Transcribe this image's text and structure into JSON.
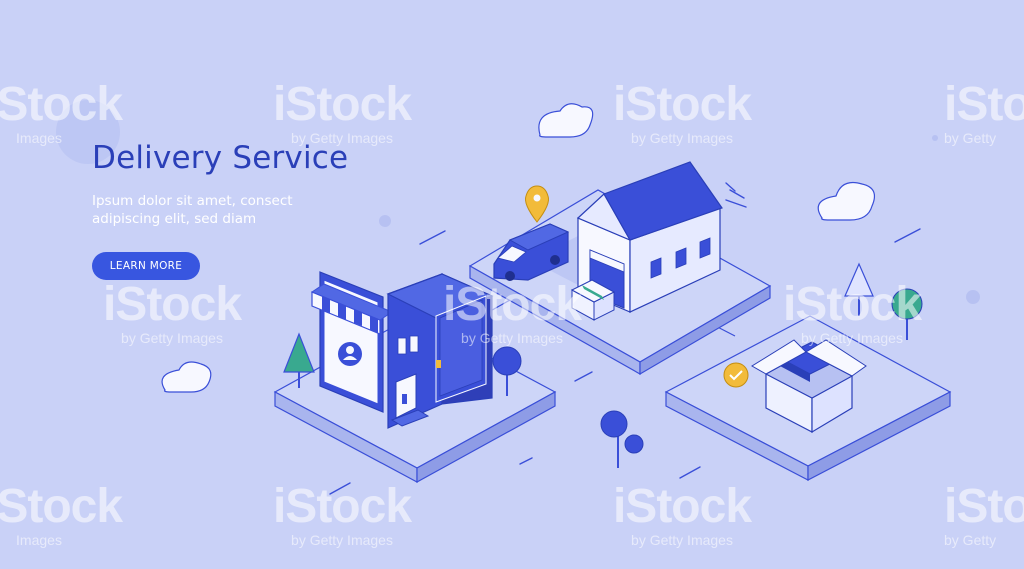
{
  "hero": {
    "title": "Delivery Service",
    "subtitle_line1": "Ipsum dolor sit amet, consect",
    "subtitle_line2": "adipiscing elit, sed diam",
    "cta_label": "LEARN MORE"
  },
  "watermark": {
    "brand": "iStock",
    "brand_partial": "iSto",
    "credit": "by Getty Images",
    "credit_short": "Images",
    "credit_partial": "by Getty"
  },
  "colors": {
    "background": "#c9d1f7",
    "primary": "#3856e0",
    "title": "#2a3fb8",
    "platform_top": "#cdd5f8",
    "platform_side": "#9aa7ea",
    "building_dark": "#3a4fd8",
    "accent_gold": "#f2bb3a"
  },
  "icons": [
    "map-pin-icon",
    "check-icon",
    "user-profile-icon",
    "awning-icon"
  ]
}
